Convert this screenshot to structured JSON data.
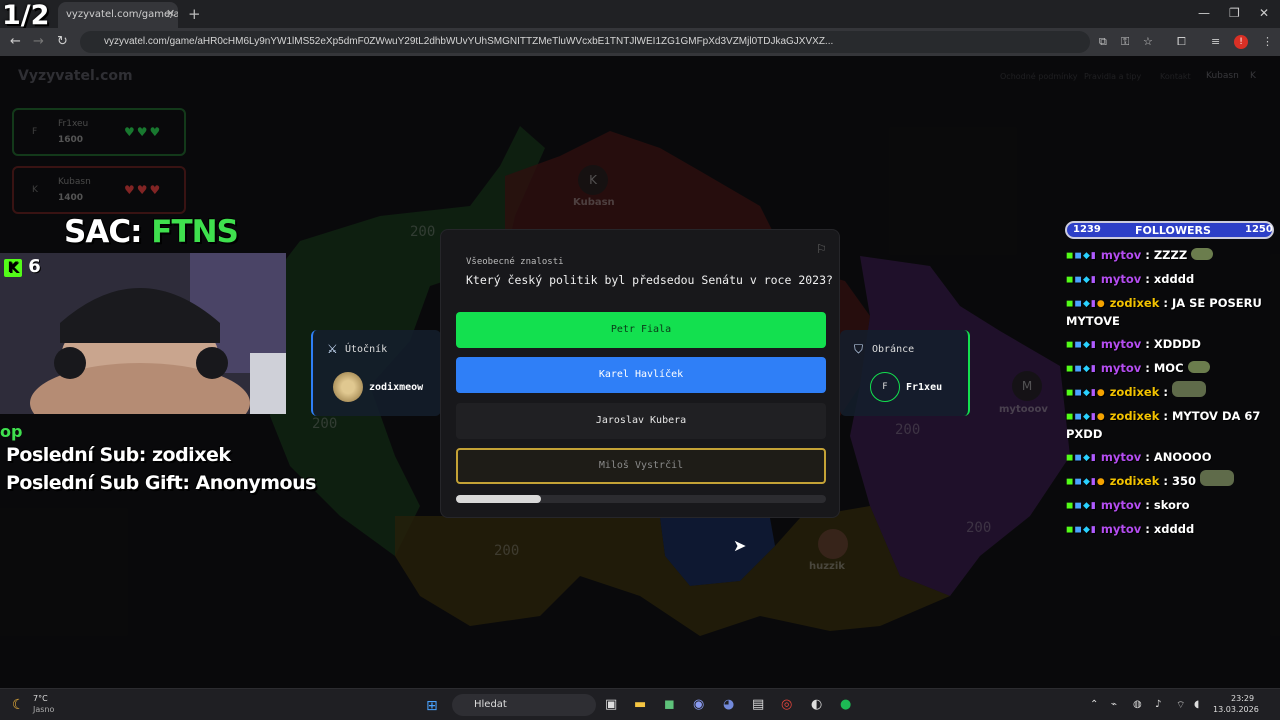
{
  "stream_counter": "1/2",
  "browser": {
    "tab_title": "vyzyvatel.com/game/aHR0cHM6",
    "tab_close": "✕",
    "new_tab": "+",
    "url": "vyzyvatel.com/game/aHR0cHM6Ly9nYW1lMS52eXp5dmF0ZWwuY29tL2dhbWUvYUhSMGNITTZMeTluWVcxbE1TNTJlWEI1ZG1GMFpXd3VZMjl0TDJkaGJXVXZ..."
  },
  "site": {
    "logo": "Vyzyvatel.com",
    "nav": [
      "Ochodné podmínky",
      "Pravidla a tipy",
      "Kontakt"
    ],
    "user": "Kubasn",
    "user_initial": "K"
  },
  "players": [
    {
      "initial": "F",
      "name": "Fr1xeu",
      "score": "1600",
      "hearts": "♥♥♥",
      "color": "#27c24c"
    },
    {
      "initial": "K",
      "name": "Kubasn",
      "score": "1400",
      "hearts": "♥♥♥",
      "color": "#d13a3a"
    }
  ],
  "map": {
    "regions": [
      "200",
      "200",
      "200",
      "200",
      "200",
      "200"
    ],
    "tokens": [
      {
        "initial": "K",
        "name": "Kubasn"
      },
      {
        "initial": "M",
        "name": "mytooov"
      },
      {
        "initial": "",
        "name": "huzzik"
      }
    ]
  },
  "attacker": {
    "label": "Útočník",
    "icon": "sword-icon",
    "name": "zodixmeow"
  },
  "defender": {
    "label": "Obránce",
    "icon": "shield-icon",
    "initial": "F",
    "name": "Fr1xeu"
  },
  "question": {
    "category": "Všeobecné znalosti",
    "text": "Který český politik byl předsedou Senátu v roce 2023?",
    "answers": [
      "Petr Fiala",
      "Karel Havlíček",
      "Jaroslav Kubera",
      "Miloš Vystrčil"
    ],
    "answer_colors": {
      "correct": "#13e04f",
      "selected": "#2f7ff7",
      "highlight": "#c4a236"
    },
    "timer_remaining": 0.23
  },
  "overlay": {
    "sac_prefix": "SAC:",
    "sac_team": "FTNS",
    "kick_count": "6",
    "kick_badge": "K",
    "op": "op",
    "last_sub": "Poslední Sub: zodixek",
    "last_sub_gift": "Poslední Sub Gift: Anonymous"
  },
  "followers": {
    "current": "1239",
    "label": "FOLLOWERS",
    "goal": "1250"
  },
  "chat": [
    {
      "user": "mytov",
      "text": "ZZZZ",
      "emote": true,
      "coin": false
    },
    {
      "user": "mytov",
      "text": "xdddd",
      "emote": false,
      "coin": false
    },
    {
      "user": "zodixek",
      "text": "JA SE POSERU MYTOVE",
      "emote": false,
      "coin": true
    },
    {
      "user": "mytov",
      "text": "XDDDD",
      "emote": false,
      "coin": false
    },
    {
      "user": "mytov",
      "text": "MOC",
      "emote": true,
      "coin": false
    },
    {
      "user": "zodixek",
      "text": "",
      "emote": true,
      "coin": true
    },
    {
      "user": "zodixek",
      "text": "MYTOV DA 67 PXDD",
      "emote": false,
      "coin": true
    },
    {
      "user": "mytov",
      "text": "ANOOOO",
      "emote": false,
      "coin": false
    },
    {
      "user": "zodixek",
      "text": "350",
      "emote": true,
      "coin": true
    },
    {
      "user": "mytov",
      "text": "skoro",
      "emote": false,
      "coin": false
    },
    {
      "user": "mytov",
      "text": "xdddd",
      "emote": false,
      "coin": false
    }
  ],
  "taskbar": {
    "temp": "7°C",
    "weather": "Jasno",
    "search_placeholder": "Hledat",
    "time": "23:29",
    "date": "13.03.2026"
  }
}
